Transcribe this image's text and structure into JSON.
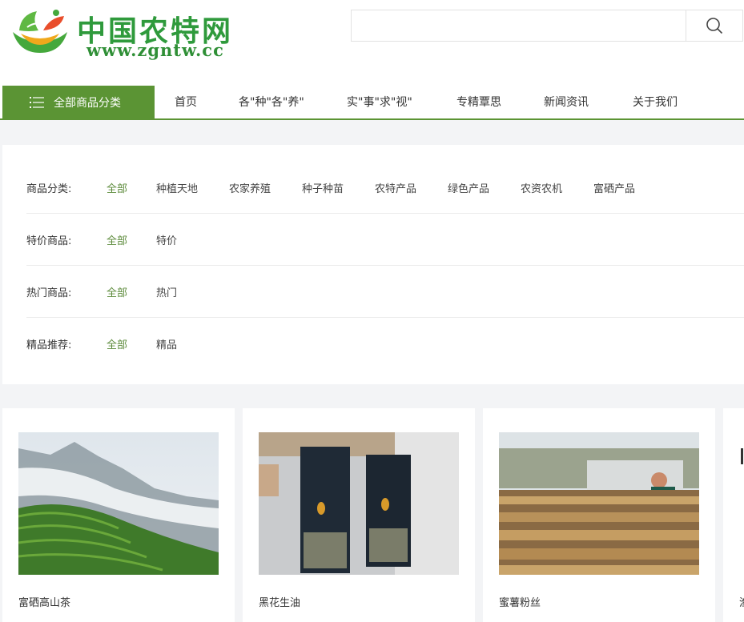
{
  "header": {
    "logo_title": "中国农特网",
    "logo_url": "www.zgntw.cc",
    "search_placeholder": ""
  },
  "nav": {
    "category_button": "全部商品分类",
    "items": [
      "首页",
      "各\"种\"各\"养\"",
      "实\"事\"求\"视\"",
      "专精覃思",
      "新闻资讯",
      "关于我们"
    ]
  },
  "filters": [
    {
      "label": "商品分类:",
      "options": [
        "全部",
        "种植天地",
        "农家养殖",
        "种子种苗",
        "农特产品",
        "绿色产品",
        "农资农机",
        "富硒产品"
      ]
    },
    {
      "label": "特价商品:",
      "options": [
        "全部",
        "特价"
      ]
    },
    {
      "label": "热门商品:",
      "options": [
        "全部",
        "热门"
      ]
    },
    {
      "label": "精品推荐:",
      "options": [
        "全部",
        "精品"
      ]
    }
  ],
  "products": [
    {
      "name": "富硒高山茶",
      "icon": "tea-plantation-image"
    },
    {
      "name": "黑花生油",
      "icon": "peanut-oil-image"
    },
    {
      "name": "蜜薯粉丝",
      "icon": "sweet-potato-vermicelli-image"
    },
    {
      "name": "渔",
      "icon": "product-image"
    }
  ],
  "colors": {
    "brand_green": "#5b9434",
    "logo_green": "#2f9a3c",
    "active_option": "#5b8a3a"
  }
}
